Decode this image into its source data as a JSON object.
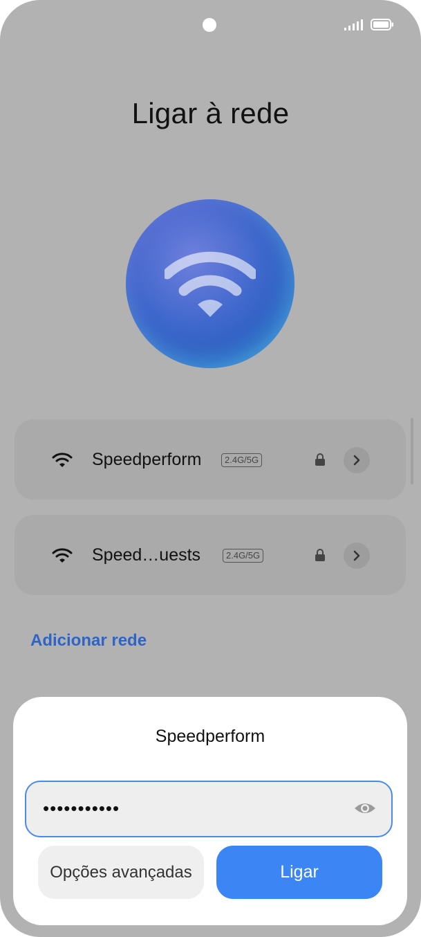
{
  "status_bar": {
    "signal_icon": "signal-icon",
    "battery_icon": "battery-icon"
  },
  "page": {
    "title": "Ligar à rede",
    "hero_icon": "wifi-icon"
  },
  "networks": [
    {
      "name": "Speedperform",
      "band": "2.4G/5G",
      "secured": true
    },
    {
      "name": "Speed…uests",
      "band": "2.4G/5G",
      "secured": true
    }
  ],
  "add_network_label": "Adicionar rede",
  "dialog": {
    "title": "Speedperform",
    "password_value": "•••••••••••",
    "advanced_label": "Opções avançadas",
    "connect_label": "Ligar"
  },
  "colors": {
    "accent": "#3b86f4",
    "link": "#2e64c6",
    "backdrop": "#b2b2b2"
  }
}
